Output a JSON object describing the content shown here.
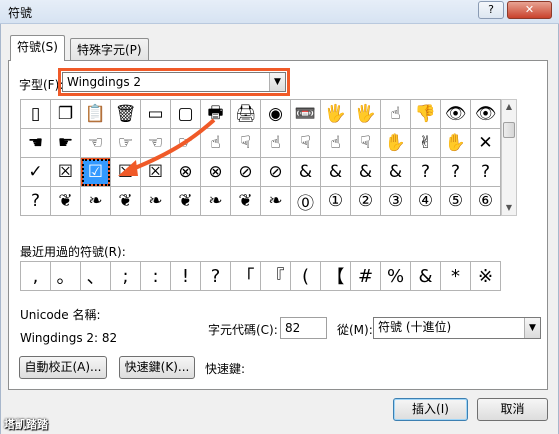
{
  "window": {
    "title": "符號",
    "help": "?",
    "close": "✕"
  },
  "tabs": [
    {
      "label": "符號(S)",
      "active": true
    },
    {
      "label": "特殊字元(P)",
      "active": false
    }
  ],
  "font": {
    "label": "字型(F):",
    "value": "Wingdings 2"
  },
  "symbols": [
    [
      "▯",
      "❐",
      "📋",
      "🗑",
      "▭",
      "▢",
      "🖶",
      "🖨",
      "◉",
      "📼",
      "🖐",
      "🖐",
      "☝",
      "👎",
      "👁",
      "👁"
    ],
    [
      "☚",
      "☛",
      "☜",
      "☞",
      "☜",
      "☞",
      "☝",
      "☟",
      "☝",
      "☟",
      "☝",
      "☟",
      "✋",
      "✌",
      "✋",
      "✕"
    ],
    [
      "✓",
      "☒",
      "☑",
      "☒",
      "☒",
      "⊗",
      "⊗",
      "⊘",
      "⊘",
      "&",
      "&",
      "&",
      "&",
      "?",
      "?",
      "?"
    ],
    [
      "?",
      "❦",
      "❧",
      "❦",
      "❧",
      "❦",
      "❧",
      "❦",
      "❧",
      "⓪",
      "①",
      "②",
      "③",
      "④",
      "⑤",
      "⑥"
    ]
  ],
  "selected": {
    "row": 2,
    "col": 2
  },
  "recent": {
    "label": "最近用過的符號(R):",
    "items": [
      ",",
      "。",
      "、",
      ";",
      ":",
      "!",
      "?",
      "「",
      "『",
      "(",
      "【",
      "#",
      "%",
      "&",
      "*",
      "※"
    ]
  },
  "unicode": {
    "label": "Unicode 名稱:",
    "value": "Wingdings 2: 82"
  },
  "charcode": {
    "label": "字元代碼(C):",
    "value": "82"
  },
  "from": {
    "label": "從(M):",
    "value": "符號 (十進位)"
  },
  "buttons": {
    "autocorrect": "自動校正(A)...",
    "shortcut": "快速鍵(K)...",
    "shortcut_label": "快速鍵:",
    "insert": "插入(I)",
    "cancel": "取消"
  },
  "watermark": "塔凱踏踏",
  "colors": {
    "annotation": "#f05a28",
    "selection": "#3399ff"
  }
}
